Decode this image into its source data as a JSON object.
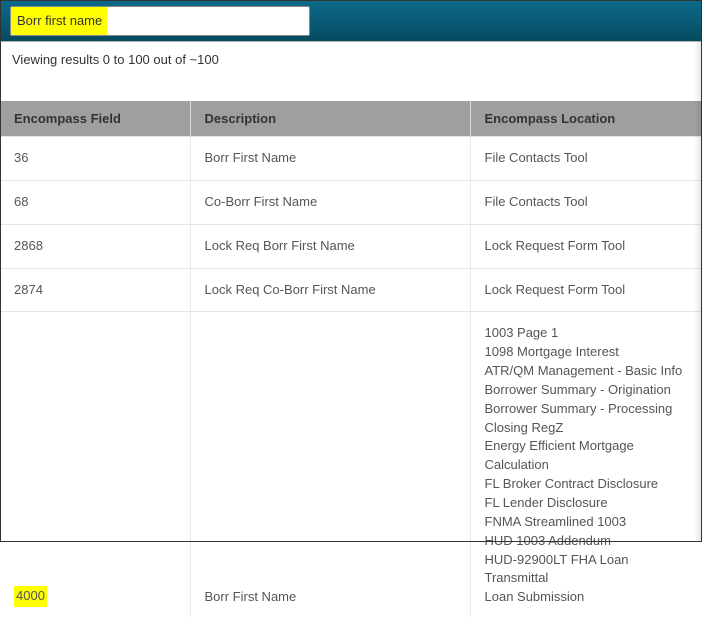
{
  "search": {
    "value": "Borr first name"
  },
  "results_info": "Viewing results 0 to 100 out of ~100",
  "columns": {
    "field": "Encompass Field",
    "desc": "Description",
    "loc": "Encompass Location"
  },
  "rows": [
    {
      "field": "36",
      "desc": "Borr First Name",
      "loc": [
        "File Contacts Tool"
      ]
    },
    {
      "field": "68",
      "desc": "Co-Borr First Name",
      "loc": [
        "File Contacts Tool"
      ]
    },
    {
      "field": "2868",
      "desc": "Lock Req Borr First Name",
      "loc": [
        "Lock Request Form Tool"
      ]
    },
    {
      "field": "2874",
      "desc": "Lock Req Co-Borr First Name",
      "loc": [
        "Lock Request Form Tool"
      ]
    },
    {
      "field": "4000",
      "highlighted": true,
      "desc": "Borr First Name",
      "loc": [
        "1003 Page 1",
        "1098 Mortgage Interest",
        "ATR/QM Management - Basic Info",
        "Borrower Summary - Origination",
        "Borrower Summary - Processing",
        "Closing RegZ",
        "Energy Efficient Mortgage Calculation",
        "FL Broker Contract Disclosure",
        "FL Lender Disclosure",
        "FNMA Streamlined 1003",
        "HUD 1003 Addendum",
        "HUD-92900LT FHA Loan Transmittal",
        "Loan Submission"
      ]
    }
  ]
}
